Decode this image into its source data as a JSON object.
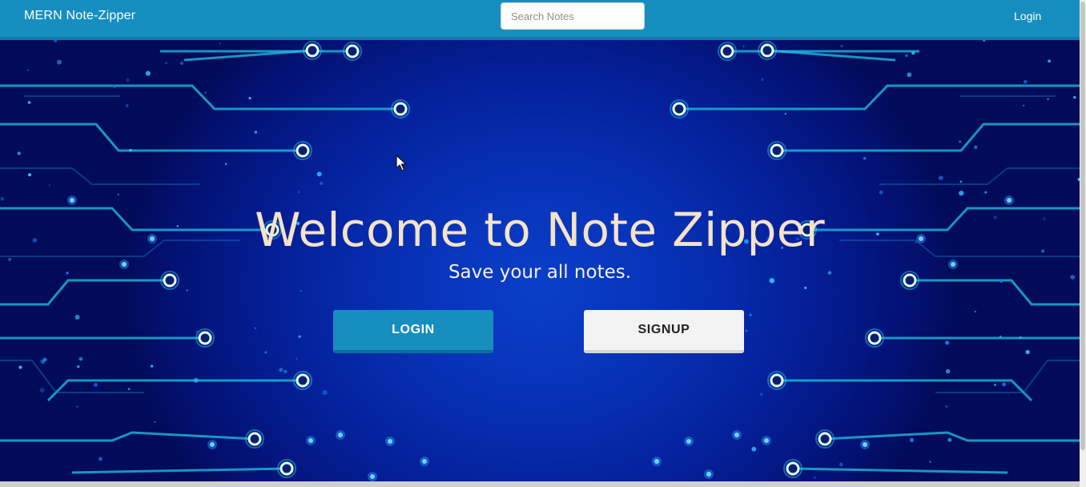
{
  "navbar": {
    "brand": "MERN Note-Zipper",
    "search_placeholder": "Search Notes",
    "login_link": "Login"
  },
  "hero": {
    "title": "Welcome to Note Zipper",
    "subtitle": "Save your all notes.",
    "login_button": "LOGIN",
    "signup_button": "SIGNUP"
  },
  "colors": {
    "navbar": "#178ec0",
    "hero_background": "#0733b8",
    "circuit_line": "#1fc6e0",
    "title_text": "#f4e3c9",
    "login_button": "#178ec0",
    "signup_button": "#f3f3f3"
  }
}
